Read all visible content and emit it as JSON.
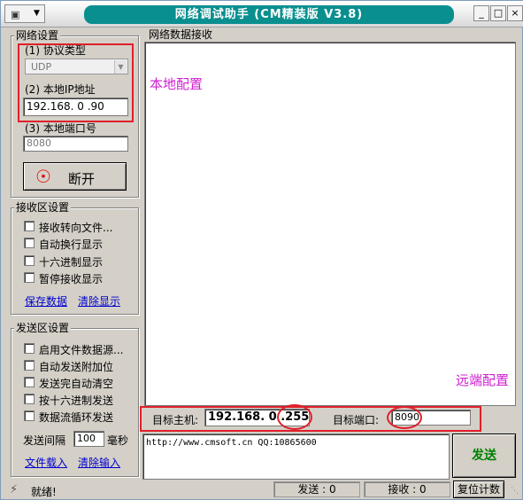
{
  "window": {
    "title": "网络调试助手 (CM精装版 V3.8)",
    "controls": {
      "minimize": "_",
      "maximize": "□",
      "close": "×"
    },
    "sysmenu_icon": "network-app-icon",
    "sysmenu_arrow": "▼"
  },
  "network_settings": {
    "group_label": "网络设置",
    "protocol_label": "(1) 协议类型",
    "protocol_value": "UDP",
    "local_ip_label": "(2) 本地IP地址",
    "local_ip_value": "192.168. 0 .90",
    "local_port_label": "(3) 本地端口号",
    "local_port_value": "8080",
    "disconnect_button": "断开",
    "status_dot_color": "#e00000"
  },
  "receive_settings": {
    "group_label": "接收区设置",
    "options": [
      {
        "label": "接收转向文件...",
        "checked": false
      },
      {
        "label": "自动换行显示",
        "checked": false
      },
      {
        "label": "十六进制显示",
        "checked": false
      },
      {
        "label": "暂停接收显示",
        "checked": false
      }
    ],
    "save_link": "保存数据",
    "clear_link": "清除显示"
  },
  "send_settings": {
    "group_label": "发送区设置",
    "options": [
      {
        "label": "启用文件数据源...",
        "checked": false
      },
      {
        "label": "自动发送附加位",
        "checked": false
      },
      {
        "label": "发送完自动清空",
        "checked": false
      },
      {
        "label": "按十六进制发送",
        "checked": false
      },
      {
        "label": "数据流循环发送",
        "checked": false
      }
    ],
    "interval_label": "发送间隔",
    "interval_value": "100",
    "interval_unit": "毫秒",
    "load_file_link": "文件载入",
    "clear_input_link": "清除输入"
  },
  "receive_area": {
    "group_label": "网络数据接收",
    "annotation_local": "本地配置",
    "annotation_remote": "远端配置"
  },
  "target": {
    "host_label": "目标主机:",
    "host_value": "192.168. 0 .255",
    "port_label": "目标端口:",
    "port_value": "8090"
  },
  "send_area": {
    "text": "http://www.cmsoft.cn QQ:10865600",
    "send_button": "发送"
  },
  "status_bar": {
    "ready_text": "就绪!",
    "sent_label": "发送 : 0",
    "received_label": "接收 : 0",
    "reset_button": "复位计数"
  },
  "colors": {
    "title_bar": "#0a8f8f",
    "annotation": "#d020d0",
    "highlight_box": "#e0202a",
    "send_button_text": "#008000"
  }
}
